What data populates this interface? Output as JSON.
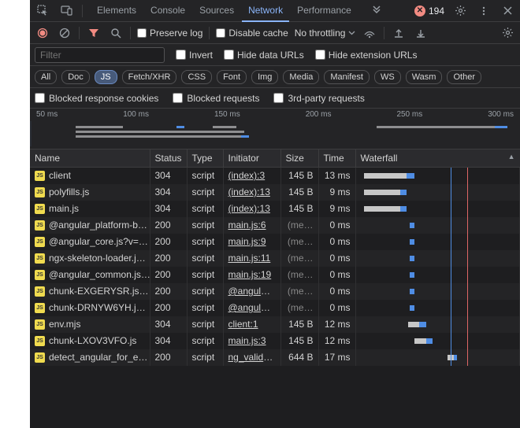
{
  "tabs": {
    "items": [
      "Elements",
      "Console",
      "Sources",
      "Network",
      "Performance"
    ],
    "active": "Network",
    "error_count": "194"
  },
  "toolbar": {
    "preserve_log": "Preserve log",
    "disable_cache": "Disable cache",
    "throttling": "No throttling"
  },
  "filter": {
    "placeholder": "Filter",
    "invert": "Invert",
    "hide_data": "Hide data URLs",
    "hide_ext": "Hide extension URLs"
  },
  "types": [
    "All",
    "Doc",
    "JS",
    "Fetch/XHR",
    "CSS",
    "Font",
    "Img",
    "Media",
    "Manifest",
    "WS",
    "Wasm",
    "Other"
  ],
  "types_active": "JS",
  "extras": {
    "blocked_resp": "Blocked response cookies",
    "blocked_req": "Blocked requests",
    "third_party": "3rd-party requests"
  },
  "overview_ticks": [
    "50 ms",
    "100 ms",
    "150 ms",
    "200 ms",
    "250 ms",
    "300 ms"
  ],
  "columns": {
    "name": "Name",
    "status": "Status",
    "type": "Type",
    "initiator": "Initiator",
    "size": "Size",
    "time": "Time",
    "waterfall": "Waterfall"
  },
  "rows": [
    {
      "name": "client",
      "status": "304",
      "type": "script",
      "initiator": "(index):3",
      "size": "145 B",
      "time": "13 ms",
      "wf_start": 5,
      "wf_len": 26,
      "tail": 5
    },
    {
      "name": "polyfills.js",
      "status": "304",
      "type": "script",
      "initiator": "(index):13",
      "size": "145 B",
      "time": "9 ms",
      "wf_start": 5,
      "wf_len": 22,
      "tail": 4
    },
    {
      "name": "main.js",
      "status": "304",
      "type": "script",
      "initiator": "(index):13",
      "size": "145 B",
      "time": "9 ms",
      "wf_start": 5,
      "wf_len": 22,
      "tail": 4
    },
    {
      "name": "@angular_platform-b…",
      "status": "200",
      "type": "script",
      "initiator": "main.js:6",
      "size": "(me…",
      "time": "0 ms",
      "wf_start": 33,
      "wf_len": 0,
      "tail": 3
    },
    {
      "name": "@angular_core.js?v=…",
      "status": "200",
      "type": "script",
      "initiator": "main.js:9",
      "size": "(me…",
      "time": "0 ms",
      "wf_start": 33,
      "wf_len": 0,
      "tail": 3
    },
    {
      "name": "ngx-skeleton-loader.j…",
      "status": "200",
      "type": "script",
      "initiator": "main.js:11",
      "size": "(me…",
      "time": "0 ms",
      "wf_start": 33,
      "wf_len": 0,
      "tail": 3
    },
    {
      "name": "@angular_common.js…",
      "status": "200",
      "type": "script",
      "initiator": "main.js:19",
      "size": "(me…",
      "time": "0 ms",
      "wf_start": 33,
      "wf_len": 0,
      "tail": 3
    },
    {
      "name": "chunk-EXGERYSR.js…",
      "status": "200",
      "type": "script",
      "initiator": "@angular_…",
      "size": "(me…",
      "time": "0 ms",
      "wf_start": 33,
      "wf_len": 0,
      "tail": 3
    },
    {
      "name": "chunk-DRNYW6YH.j…",
      "status": "200",
      "type": "script",
      "initiator": "@angular_…",
      "size": "(me…",
      "time": "0 ms",
      "wf_start": 33,
      "wf_len": 0,
      "tail": 3
    },
    {
      "name": "env.mjs",
      "status": "304",
      "type": "script",
      "initiator": "client:1",
      "size": "145 B",
      "time": "12 ms",
      "wf_start": 32,
      "wf_len": 7,
      "tail": 4
    },
    {
      "name": "chunk-LXOV3VFO.js",
      "status": "304",
      "type": "script",
      "initiator": "main.js:3",
      "size": "145 B",
      "time": "12 ms",
      "wf_start": 36,
      "wf_len": 7,
      "tail": 4
    },
    {
      "name": "detect_angular_for_e…",
      "status": "200",
      "type": "script",
      "initiator": "ng_validat…",
      "size": "644 B",
      "time": "17 ms",
      "wf_start": 56,
      "wf_len": 4,
      "tail": 2
    }
  ]
}
